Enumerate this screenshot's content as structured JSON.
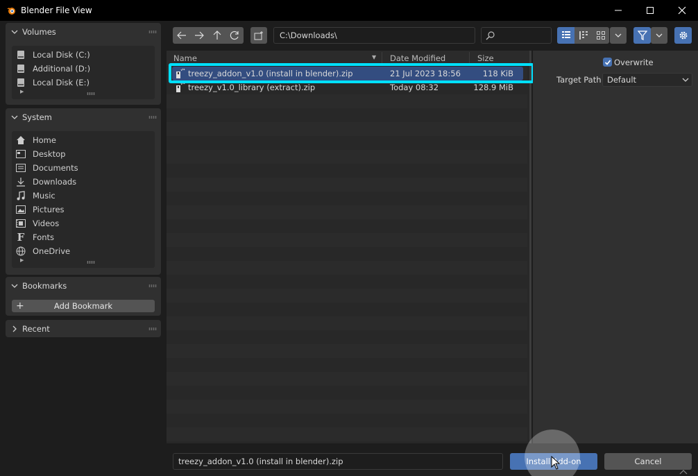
{
  "window": {
    "title": "Blender File View",
    "controls": [
      "minimize-icon",
      "maximize-icon",
      "close-icon"
    ]
  },
  "sidebar": {
    "volumes": {
      "header": "Volumes",
      "items": [
        {
          "label": "Local Disk (C:)",
          "icon": "disk-icon"
        },
        {
          "label": "Additional (D:)",
          "icon": "disk-icon"
        },
        {
          "label": "Local Disk (E:)",
          "icon": "disk-icon"
        }
      ]
    },
    "system": {
      "header": "System",
      "items": [
        {
          "label": "Home",
          "icon": "home-icon"
        },
        {
          "label": "Desktop",
          "icon": "desktop-icon"
        },
        {
          "label": "Documents",
          "icon": "documents-icon"
        },
        {
          "label": "Downloads",
          "icon": "downloads-icon"
        },
        {
          "label": "Music",
          "icon": "music-icon"
        },
        {
          "label": "Pictures",
          "icon": "pictures-icon"
        },
        {
          "label": "Videos",
          "icon": "videos-icon"
        },
        {
          "label": "Fonts",
          "icon": "fonts-icon"
        },
        {
          "label": "OneDrive",
          "icon": "globe-icon"
        }
      ]
    },
    "bookmarks": {
      "header": "Bookmarks",
      "add_label": "Add Bookmark"
    },
    "recent": {
      "header": "Recent"
    }
  },
  "toolbar": {
    "path": "C:\\Downloads\\",
    "search_value": ""
  },
  "file_list": {
    "columns": {
      "name": "Name",
      "date": "Date Modified",
      "size": "Size"
    },
    "rows": [
      {
        "name": "treezy_addon_v1.0 (install in blender).zip",
        "date": "21 Jul 2023 18:56",
        "size": "118 KiB",
        "selected": true
      },
      {
        "name": "treezy_v1.0_library (extract).zip",
        "date": "Today 08:32",
        "size": "128.9 MiB",
        "selected": false
      }
    ]
  },
  "options": {
    "overwrite_label": "Overwrite",
    "overwrite_checked": true,
    "target_path_label": "Target Path",
    "target_path_value": "Default"
  },
  "footer": {
    "filename": "treezy_addon_v1.0 (install in blender).zip",
    "install_label": "Install Add-on",
    "cancel_label": "Cancel"
  },
  "colors": {
    "accent": "#4772b3",
    "selection": "#334d80",
    "highlight": "#00e0ff"
  }
}
